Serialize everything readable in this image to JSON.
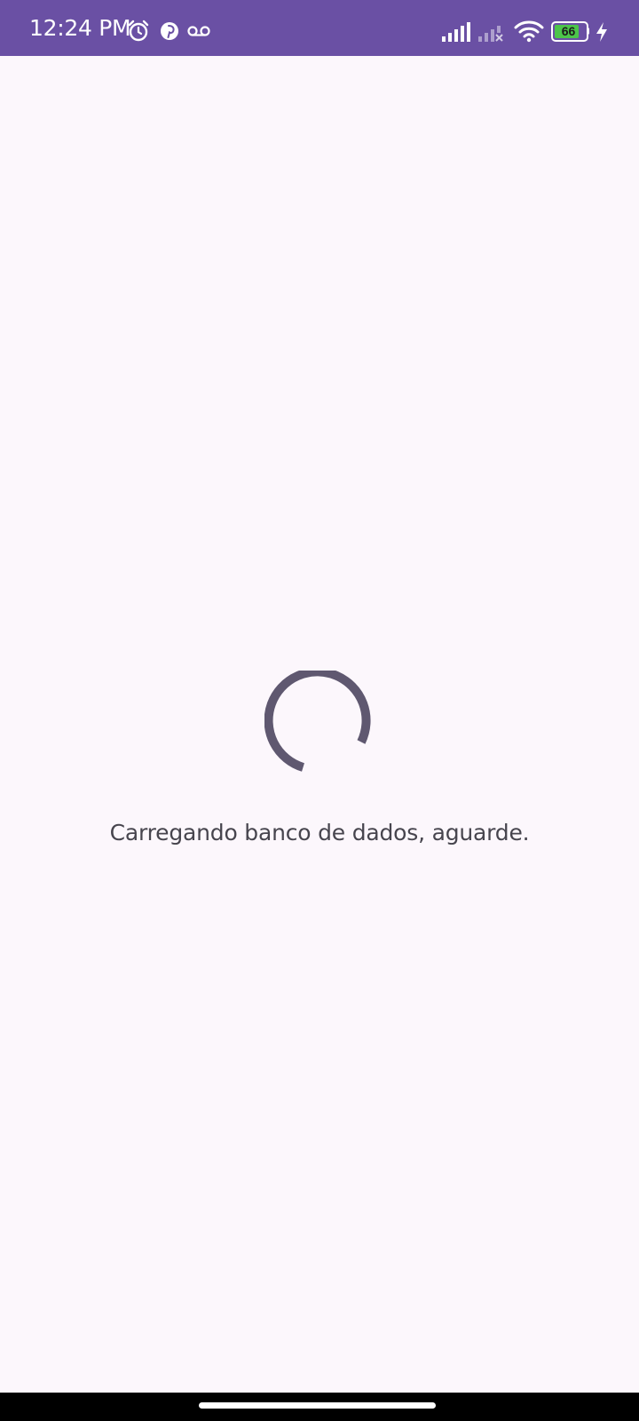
{
  "status_bar": {
    "time": "12:24 PM",
    "battery_level": "66",
    "icons": [
      "alarm-icon",
      "pinterest-icon",
      "voicemail-icon",
      "signal-icon",
      "signal-no-service-icon",
      "wifi-icon",
      "battery-icon",
      "charging-icon"
    ]
  },
  "main": {
    "loading_message": "Carregando banco de dados, aguarde."
  },
  "colors": {
    "status_bar_bg": "#6A50A4",
    "page_bg": "#FCF7FC",
    "spinner": "#5F5870",
    "text": "#47454E",
    "battery_fill": "#4CC54A",
    "nav_bar_bg": "#000000"
  }
}
